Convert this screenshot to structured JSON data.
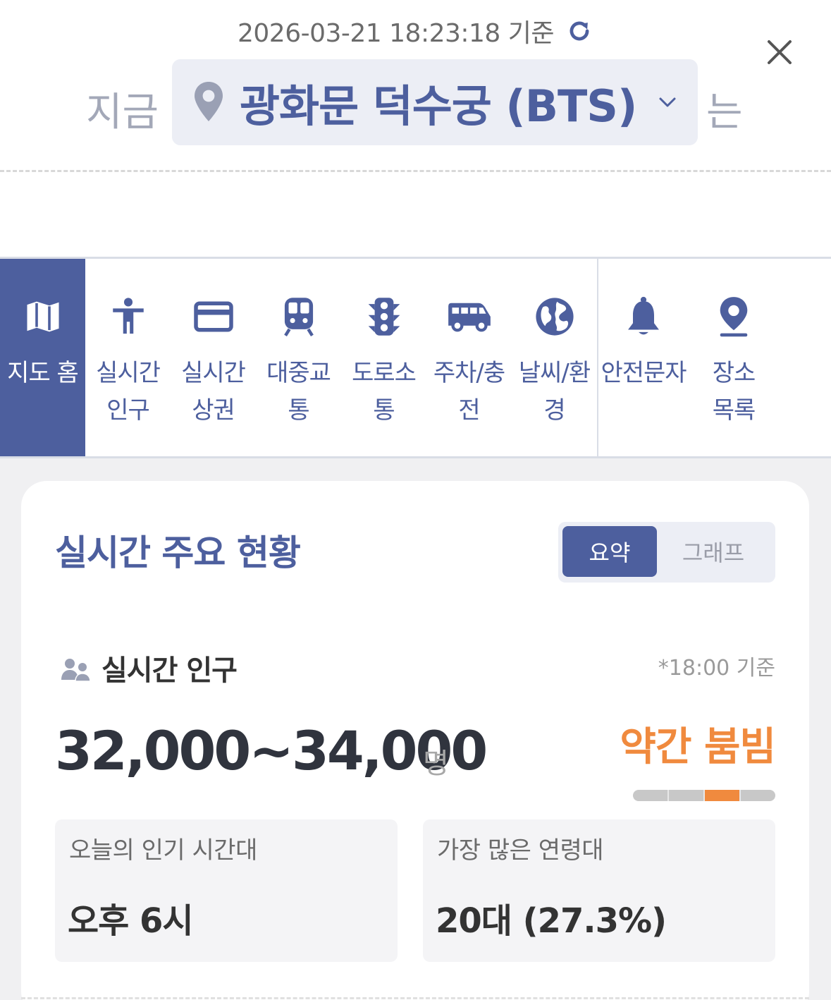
{
  "header": {
    "timestamp": "2026-03-21 18:23:18 기준",
    "prefix": "지금",
    "location": "광화문 덕수궁 (BTS)",
    "suffix": "는"
  },
  "tabs": [
    {
      "label": "지도 홈",
      "icon": "map-icon",
      "active": true
    },
    {
      "label": "실시간\n인구",
      "icon": "person-icon",
      "active": false
    },
    {
      "label": "실시간\n상권",
      "icon": "credit-card-icon",
      "active": false
    },
    {
      "label": "대중교통",
      "icon": "train-icon",
      "active": false
    },
    {
      "label": "도로소통",
      "icon": "traffic-light-icon",
      "active": false
    },
    {
      "label": "주차/충전",
      "icon": "van-icon",
      "active": false
    },
    {
      "label": "날씨/환경",
      "icon": "globe-icon",
      "active": false
    },
    {
      "label": "안전문자",
      "icon": "bell-icon",
      "active": false
    },
    {
      "label": "장소\n목록",
      "icon": "location-pin-icon",
      "active": false
    }
  ],
  "card": {
    "title": "실시간 주요 현황",
    "toggle": {
      "selected": "요약",
      "other": "그래프"
    },
    "population": {
      "section_title": "실시간 인구",
      "basis_note": "*18:00 기준",
      "range": "32,000~34,000",
      "unit": "명",
      "level_label": "약간 붐빔",
      "level_index": 3,
      "level_count": 4
    },
    "stats": [
      {
        "label": "오늘의 인기 시간대",
        "value": "오후 6시"
      },
      {
        "label": "가장 많은 연령대",
        "value": "20대 (27.3%)"
      }
    ]
  },
  "colors": {
    "accent": "#4d5f9e",
    "level": "#f08a3e",
    "muted": "#a3a8b8"
  }
}
